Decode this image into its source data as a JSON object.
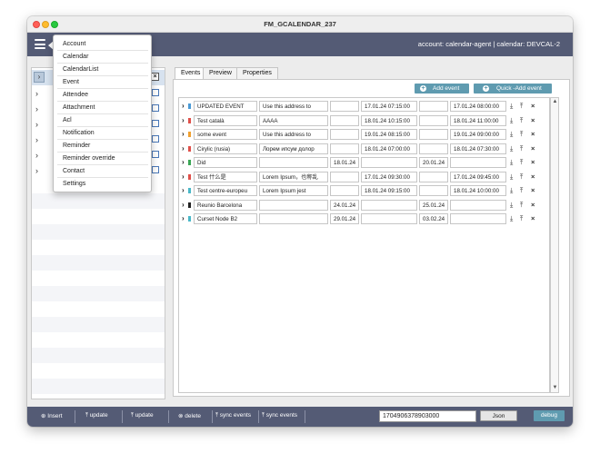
{
  "window": {
    "title": "FM_GCALENDAR_237"
  },
  "header": {
    "account_info": "account: calendar-agent | calendar: DEVCAL-2"
  },
  "menu": {
    "items": [
      "Account",
      "Calendar",
      "CalendarList",
      "Event",
      "Attendee",
      "Attachment",
      "Acl",
      "Notification",
      "Reminder",
      "Reminder override",
      "Contact",
      "Settings"
    ]
  },
  "left_panel": {
    "close_glyph": "×"
  },
  "tabs": [
    "Events",
    "Preview",
    "Properties"
  ],
  "events_header": {
    "add_event": "Add event",
    "quick_add_event": "Quick -Add event"
  },
  "events": [
    {
      "summary": "UPDATED EVENT",
      "description": "Use this address to",
      "start_date": "",
      "start_datetime": "17.01.24 07:15:00",
      "end_date": "",
      "end_datetime": "17.01.24 08:00:00",
      "color": "#4a9ad6"
    },
    {
      "summary": "Test català",
      "description": "AAAA",
      "start_date": "",
      "start_datetime": "18.01.24 10:15:00",
      "end_date": "",
      "end_datetime": "18.01.24 11:00:00",
      "color": "#e0504a"
    },
    {
      "summary": "some event",
      "description": "Use this address to",
      "start_date": "",
      "start_datetime": "19.01.24 08:15:00",
      "end_date": "",
      "end_datetime": "19.01.24 09:00:00",
      "color": "#f0a030"
    },
    {
      "summary": "Cirylic (rusia)",
      "description": "Лорем ипсум долор",
      "start_date": "",
      "start_datetime": "18.01.24 07:00:00",
      "end_date": "",
      "end_datetime": "18.01.24 07:30:00",
      "color": "#e0504a"
    },
    {
      "summary": "Did",
      "description": "",
      "start_date": "18.01.24",
      "start_datetime": "",
      "end_date": "20.01.24",
      "end_datetime": "",
      "color": "#3aa655"
    },
    {
      "summary": "Test 什么是",
      "description": "Lorem Ipsum，也称乱",
      "start_date": "",
      "start_datetime": "17.01.24 09:30:00",
      "end_date": "",
      "end_datetime": "17.01.24 09:45:00",
      "color": "#e0504a"
    },
    {
      "summary": "Test centre-europeu",
      "description": "Lorem Ipsum jest",
      "start_date": "",
      "start_datetime": "18.01.24 09:15:00",
      "end_date": "",
      "end_datetime": "18.01.24 10:00:00",
      "color": "#4ab8c8"
    },
    {
      "summary": "Reunio Barcelona",
      "description": "",
      "start_date": "24.01.24",
      "start_datetime": "",
      "end_date": "25.01.24",
      "end_datetime": "",
      "color": "#222222"
    },
    {
      "summary": "Curset Node B2",
      "description": "",
      "start_date": "29.01.24",
      "start_datetime": "",
      "end_date": "03.02.24",
      "end_datetime": "",
      "color": "#4ab8c8"
    }
  ],
  "bottom_bar": {
    "insert": "Insert",
    "update1": "update",
    "update2": "update",
    "delete": "delete",
    "sync1": "sync events",
    "sync2": "sync events",
    "id_value": "1704906378903000",
    "json": "Json",
    "debug": "debug"
  },
  "colors": {
    "header_bg": "#545b75",
    "accent": "#5f9bb0"
  }
}
